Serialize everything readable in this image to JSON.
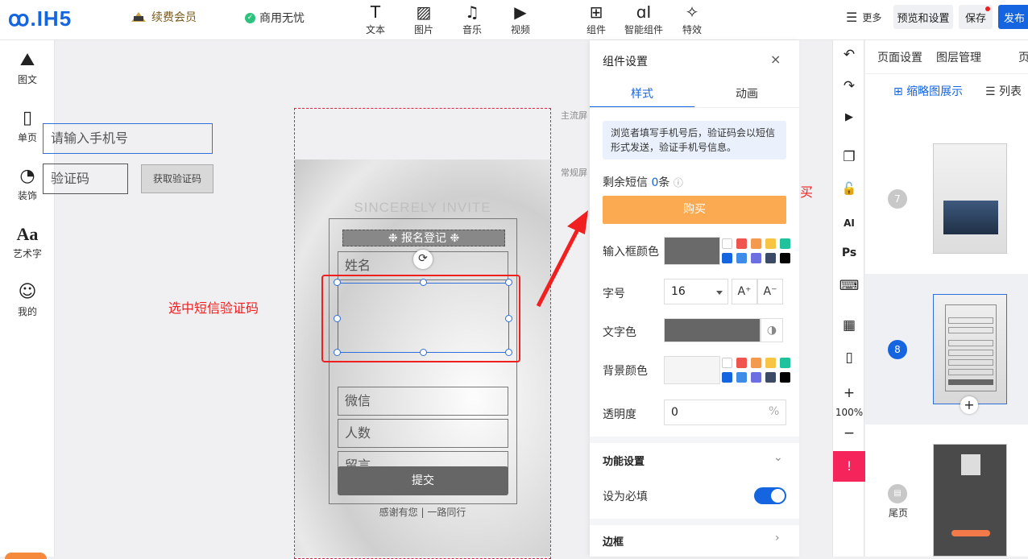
{
  "header": {
    "logo": "ꝏ.IH5",
    "vip": "续费会员",
    "commercial": "商用无忧",
    "tools": [
      {
        "label": "文本",
        "icon": "T"
      },
      {
        "label": "图片",
        "icon": "▨"
      },
      {
        "label": "音乐",
        "icon": "♫"
      },
      {
        "label": "视频",
        "icon": "▶"
      },
      {
        "label": "组件",
        "icon": "⊞"
      },
      {
        "label": "智能组件",
        "icon": "ɑI"
      },
      {
        "label": "特效",
        "icon": "✧"
      }
    ],
    "more": "更多",
    "preview": "预览和设置",
    "save": "保存",
    "publish": "发布"
  },
  "leftbar": [
    {
      "label": "图文",
      "icon": "⛰"
    },
    {
      "label": "单页",
      "icon": "▯"
    },
    {
      "label": "装饰",
      "icon": "◔"
    },
    {
      "label": "艺术字",
      "icon": "Aa"
    },
    {
      "label": "我的",
      "icon": "☺"
    }
  ],
  "canvas": {
    "main_screen": "主流屏",
    "normal_screen": "常规屏",
    "invite": "SINCERELY INVITE",
    "reg_title": "❉ 报名登记 ❉",
    "fields": {
      "name": "姓名",
      "phone": "请输入手机号",
      "code": "验证码",
      "get_code": "获取验证码",
      "wechat": "微信",
      "people": "人数",
      "message": "留言"
    },
    "submit": "提交",
    "thanks": "感谢有您 | 一路同行"
  },
  "annotations": {
    "select": "选中短信验证码",
    "buy": "点击进行购买"
  },
  "panel": {
    "title": "组件设置",
    "close": "×",
    "tabs": [
      "样式",
      "动画"
    ],
    "tip": "浏览者填写手机号后，验证码会以短信形式发送，验证手机号信息。",
    "sms_prefix": "剩余短信 ",
    "sms_count": "0",
    "sms_suffix": "条",
    "sms_help": "ⓘ",
    "buy": "购买",
    "input_color": "输入框颜色",
    "font_size_label": "字号",
    "font_size": "16",
    "font_inc": "A⁺",
    "font_dec": "A⁻",
    "text_color": "文字色",
    "bg_color": "背景颜色",
    "opacity_label": "透明度",
    "opacity": "0",
    "opacity_unit": "%",
    "func_settings": "功能设置",
    "required": "设为必填",
    "border": "边框",
    "palette": [
      "#ffffff",
      "#f0544f",
      "#f39a4e",
      "#f7c444",
      "#1fc29a",
      "#1565e0",
      "#3e8be8",
      "#6c6fe0",
      "#3d4a66",
      "#000000"
    ],
    "input_color_value": "#6a6a6a",
    "text_color_value": "#666666",
    "bg_color_value": "#f5f5f5"
  },
  "righttools": {
    "undo": "↶",
    "redo": "↷",
    "play": "▶",
    "copy": "❐",
    "lock": "🔓",
    "ai": "AI",
    "ps": "Ps",
    "keyboard": "⌨",
    "grid": "▦",
    "mobile": "▯",
    "zoom_in": "+",
    "zoom": "100%",
    "zoom_out": "−",
    "alert": "!"
  },
  "pagelist": {
    "tabs": [
      "页面设置",
      "图层管理",
      "页"
    ],
    "view_thumb": "缩略图展示",
    "view_list": "列表",
    "pages": [
      {
        "num": "7"
      },
      {
        "num": "8"
      },
      {
        "num": "尾页"
      }
    ]
  }
}
